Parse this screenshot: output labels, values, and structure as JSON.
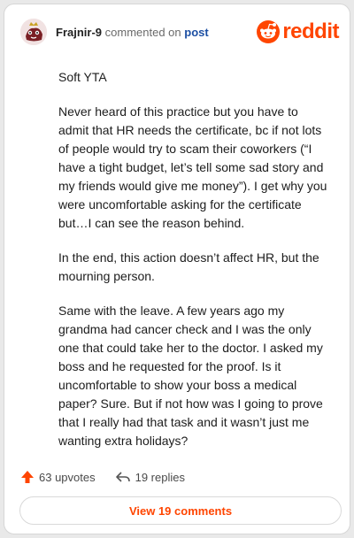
{
  "header": {
    "username": "Frajnir-9",
    "action": "commented on",
    "link": "post",
    "brand": "reddit"
  },
  "comment": {
    "paragraphs": [
      "Soft YTA",
      "Never heard of this practice but you have to admit that HR needs the certificate, bc if not lots of people would try to scam their coworkers (“I have a tight budget, let’s tell some sad story and my friends would give me money”). I get why you were uncomfortable asking for the certificate but…I can see the reason behind.",
      "In the end, this action doesn’t affect HR, but the mourning person.",
      "Same with the leave. A few years ago my grandma had cancer check and I was the only one that could take her to the doctor. I asked my boss and he requested for the proof. Is it uncomfortable to show your boss a medical paper? Sure. But if not how was I going to prove that I really had that task and it wasn’t just me wanting extra holidays?"
    ]
  },
  "footer": {
    "upvotes": "63 upvotes",
    "replies": "19 replies",
    "view_button": "View 19 comments"
  },
  "colors": {
    "accent": "#ff4500",
    "link": "#1c4fa3"
  },
  "icons": {
    "upvote": "upvote-arrow-icon",
    "reply": "reply-arrow-icon",
    "logo": "reddit-snoo-icon"
  }
}
